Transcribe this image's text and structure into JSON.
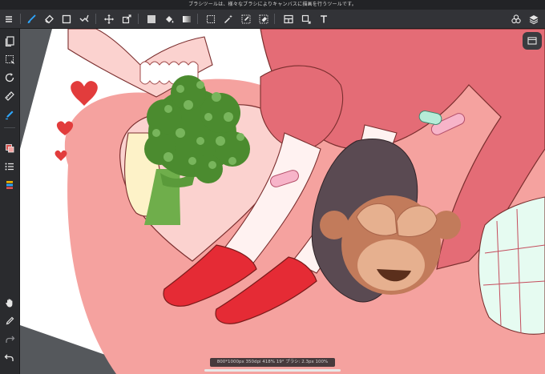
{
  "app": {
    "hint_text": "ブラシツールは、様々なブラシによりキャンバスに描画を行うツールです。"
  },
  "toolbar": {
    "left": [
      "menu-icon",
      "brush-tool-icon",
      "eraser-tool-icon",
      "rectangle-tool-icon",
      "magic-pen-icon",
      "move-tool-icon",
      "transform-tool-icon"
    ],
    "middle": [
      "fill-color-swatch-icon",
      "bucket-tool-icon",
      "gradient-tool-icon",
      "select-tool-icon",
      "magic-wand-icon",
      "select-pen-icon",
      "select-eraser-icon",
      "frame-tool-icon",
      "crop-tool-icon",
      "text-tool-icon"
    ],
    "right": [
      "materials-icon",
      "layers-icon"
    ]
  },
  "sidebar": {
    "items": [
      "pages-icon",
      "selection-icon",
      "rotate-icon",
      "ruler-icon",
      "eyedropper-toggle-icon",
      "color-icon",
      "brush-list-icon",
      "layer-panel-icon",
      "hand-tool-icon",
      "eyedropper-icon",
      "redo-icon",
      "undo-icon"
    ]
  },
  "colors": {
    "accent": "#2ea7ff",
    "toolbar_bg": "#323337",
    "sidebar_bg": "#2a2b2e",
    "canvas_bg": "#55585c",
    "paper_pink": "#f4a5a3",
    "skirt_red": "#e46c76",
    "shoe_red": "#e52b35",
    "broccoli_green": "#4b8b2f",
    "monkey_brown": "#c27b5b"
  },
  "status": {
    "text": "800*1000px 350dpi 418% 19° ブラシ: 2.3px 100%"
  }
}
